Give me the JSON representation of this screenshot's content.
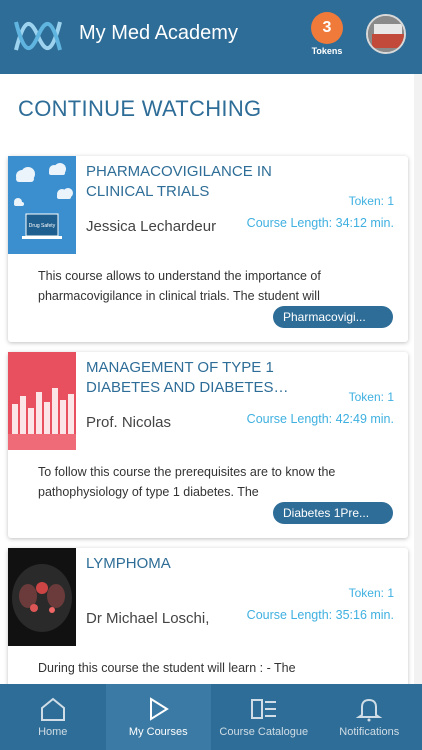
{
  "header": {
    "title": "My Med Academy",
    "tokens_count": "3",
    "tokens_label": "Tokens",
    "logo_icon": "dna-wave-logo",
    "avatar_icon": "user-avatar"
  },
  "section_title": "CONTINUE WATCHING",
  "courses": [
    {
      "title": "PHARMACOVIGILANCE IN CLINICAL TRIALS",
      "author": "Jessica Lechardeur",
      "token": "Token: 1",
      "length": "Course Length: 34:12 min.",
      "description": "This course allows to understand the importance of pharmacovigilance in clinical trials. The student will",
      "tag": "Pharmacovigi...",
      "thumb_text": "Drug Safety"
    },
    {
      "title": "MANAGEMENT OF TYPE 1 DIABETES AND DIABETES…",
      "author": "Prof. Nicolas",
      "token": "Token: 1",
      "length": "Course Length: 42:49 min.",
      "description": "To follow this course the prerequisites are to know the pathophysiology of type 1 diabetes. The",
      "tag": "Diabetes 1Pre..."
    },
    {
      "title": "LYMPHOMA",
      "author": "Dr Michael Loschi,",
      "token": "Token: 1",
      "length": "Course Length: 35:16 min.",
      "description": "During this course the student will learn : - The"
    }
  ],
  "nav": {
    "home": "Home",
    "my_courses": "My Courses",
    "catalogue": "Course Catalogue",
    "notifications": "Notifications"
  },
  "colors": {
    "primary": "#2e6d97",
    "accent": "#3fb0e0",
    "badge": "#f07a3a"
  }
}
